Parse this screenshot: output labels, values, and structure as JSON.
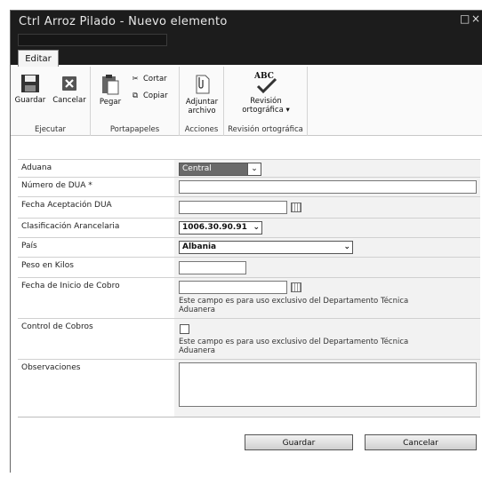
{
  "window": {
    "title": "Ctrl Arroz Pilado - Nuevo elemento",
    "maximize_glyph": "□",
    "close_glyph": "×"
  },
  "ribbon": {
    "tab_label": "Editar",
    "groups": {
      "ejecutar": {
        "label": "Ejecutar",
        "guardar": "Guardar",
        "cancelar": "Cancelar"
      },
      "portapapeles": {
        "label": "Portapapeles",
        "pegar": "Pegar",
        "cortar": "Cortar",
        "copiar": "Copiar"
      },
      "acciones": {
        "label": "Acciones",
        "adjuntar_line1": "Adjuntar",
        "adjuntar_line2": "archivo"
      },
      "revision": {
        "label": "Revisión ortográfica",
        "abc": "ABC",
        "btn_line1": "Revisión",
        "btn_line2": "ortográfica ▾"
      }
    }
  },
  "form": {
    "aduana": {
      "label": "Aduana",
      "value": "Central"
    },
    "numero_dua": {
      "label": "Número de DUA *",
      "value": ""
    },
    "fecha_aceptacion": {
      "label": "Fecha Aceptación DUA",
      "value": ""
    },
    "clasificacion": {
      "label": "Clasificación Arancelaria",
      "value": "1006.30.90.91"
    },
    "pais": {
      "label": "País",
      "value": "Albania"
    },
    "peso": {
      "label": "Peso en Kilos",
      "value": ""
    },
    "fecha_inicio_cobro": {
      "label": "Fecha de Inicio de Cobro",
      "value": "",
      "note_line1": "Este campo es para uso exclusivo del Departamento Técnica",
      "note_line2": "Aduanera"
    },
    "control_cobros": {
      "label": "Control de Cobros",
      "checked": false,
      "note_line1": "Este campo es para uso exclusivo del Departamento Técnica",
      "note_line2": "Aduanera"
    },
    "observaciones": {
      "label": "Observaciones",
      "value": ""
    }
  },
  "buttons": {
    "guardar": "Guardar",
    "cancelar": "Cancelar"
  },
  "icons": [
    "save-icon",
    "cancel-icon",
    "paste-icon",
    "cut-icon",
    "copy-icon",
    "attach-icon",
    "spellcheck-icon",
    "calendar-icon",
    "dropdown-arrow-icon"
  ]
}
